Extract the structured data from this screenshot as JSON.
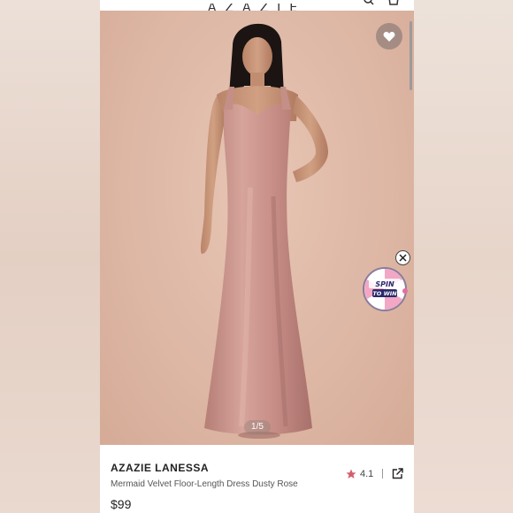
{
  "header": {
    "logo_text": "AZAZIE"
  },
  "gallery": {
    "pager": "1/5"
  },
  "promo": {
    "spin_label_1": "SPIN",
    "spin_label_2": "TO WIN"
  },
  "product": {
    "brand": "AZAZIE LANESSA",
    "name": "Mermaid Velvet Floor-Length Dress Dusty Rose",
    "price": "$99",
    "rating": "4.1"
  },
  "colors": {
    "dress": "#c9938a",
    "background": "#ddb6a4",
    "star": "#d45d6e"
  }
}
